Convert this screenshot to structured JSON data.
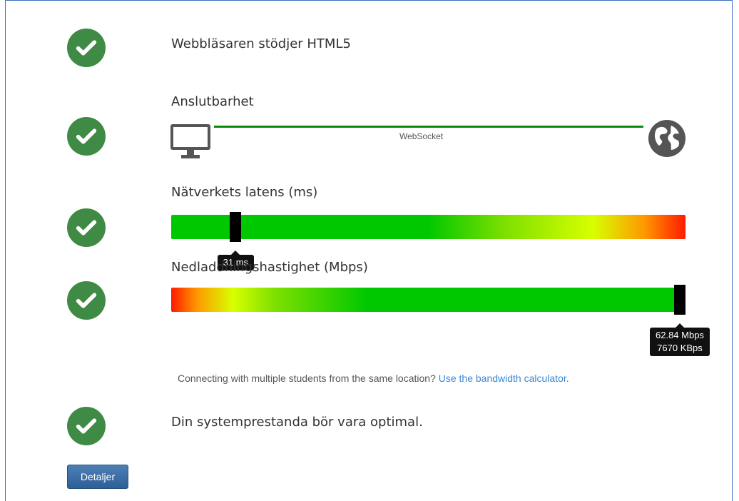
{
  "checks": {
    "html5": {
      "label": "Webbläsaren stödjer HTML5"
    },
    "connectivity": {
      "label": "Anslutbarhet",
      "connection_type": "WebSocket"
    },
    "latency": {
      "label": "Nätverkets latens (ms)",
      "value_text": "31 ms",
      "position": 0.125
    },
    "download": {
      "label": "Nedladdningshastighet (Mbps)",
      "mbps_text": "62.84 Mbps",
      "kbps_text": "7670 KBps",
      "position": 0.998
    },
    "performance": {
      "label": "Din systemprestanda bör vara optimal."
    }
  },
  "note": {
    "text": "Connecting with multiple students from the same location?",
    "link": "Use the bandwidth calculator."
  },
  "details_button": "Detaljer",
  "colors": {
    "check": "#3f8a45",
    "link": "#3a87d6",
    "connection_line": "#0a8a0a"
  },
  "icons": {
    "client": "monitor-icon",
    "server": "globe-icon",
    "status": "check-circle-icon"
  }
}
